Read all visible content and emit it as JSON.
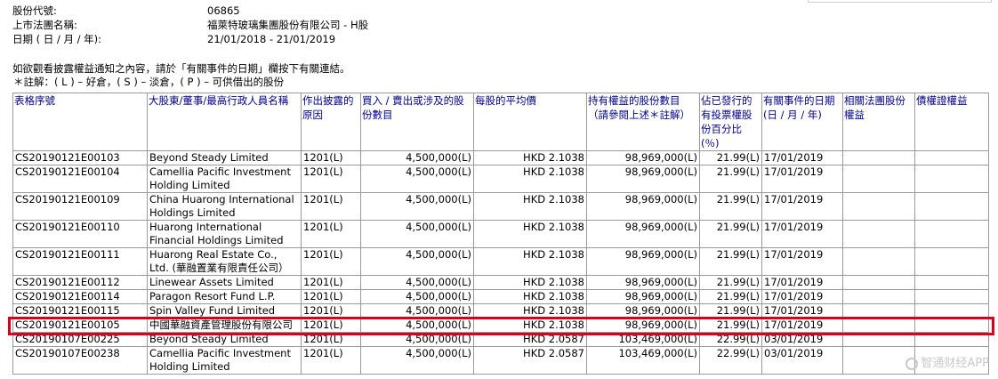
{
  "info": {
    "stock_code_label": "股份代號:",
    "stock_code": "06865",
    "company_label": "上市法團名稱:",
    "company": "福萊特玻璃集團股份有限公司 - H股",
    "date_label": "日期 ( 日 / 月 / 年):",
    "date_range": "21/01/2018 - 21/01/2019"
  },
  "notice": {
    "line1": "如欲觀看披露權益通知之內容，請於「有關事件的日期」欄按下有關連結。",
    "line2": "＊註解：(  L  ) – 好倉，(  S  ) – 淡倉，(  P  ) – 可供借出的股份"
  },
  "table": {
    "headers": [
      "表格序號",
      "大股東/董事/最高行政人員名稱",
      "作出披露的原因",
      "買入 / 賣出或涉及的股份數目",
      "每股的平均價",
      "持有權益的股份數目 （請參閱上述＊註解）",
      "佔已發行的有投票權股份百分比 (％)",
      "有關事件的日期 (日 / 月 / 年)",
      "相關法團股份權益",
      "債權證權益"
    ],
    "rows": [
      {
        "code": "CS20190121E00103",
        "name": "Beyond Steady Limited",
        "reason": "1201(L)",
        "shares": "4,500,000(L)",
        "price": "HKD 2.1038",
        "held": "98,969,000(L)",
        "pct": "21.99(L)",
        "date": "17/01/2019"
      },
      {
        "code": "CS20190121E00104",
        "name": "Camellia Pacific Investment Holding Limited",
        "reason": "1201(L)",
        "shares": "4,500,000(L)",
        "price": "HKD 2.1038",
        "held": "98,969,000(L)",
        "pct": "21.99(L)",
        "date": "17/01/2019"
      },
      {
        "code": "CS20190121E00109",
        "name": "China Huarong International Holdings Limited",
        "reason": "1201(L)",
        "shares": "4,500,000(L)",
        "price": "HKD 2.1038",
        "held": "98,969,000(L)",
        "pct": "21.99(L)",
        "date": "17/01/2019"
      },
      {
        "code": "CS20190121E00110",
        "name": "Huarong International Financial Holdings Limited",
        "reason": "1201(L)",
        "shares": "4,500,000(L)",
        "price": "HKD 2.1038",
        "held": "98,969,000(L)",
        "pct": "21.99(L)",
        "date": "17/01/2019"
      },
      {
        "code": "CS20190121E00111",
        "name": "Huarong Real Estate Co., Ltd. (華融置業有限責任公司）",
        "reason": "1201(L)",
        "shares": "4,500,000(L)",
        "price": "HKD 2.1038",
        "held": "98,969,000(L)",
        "pct": "21.99(L)",
        "date": "17/01/2019"
      },
      {
        "code": "CS20190121E00112",
        "name": "Linewear Assets Limited",
        "reason": "1201(L)",
        "shares": "4,500,000(L)",
        "price": "HKD 2.1038",
        "held": "98,969,000(L)",
        "pct": "21.99(L)",
        "date": "17/01/2019"
      },
      {
        "code": "CS20190121E00114",
        "name": "Paragon Resort Fund L.P.",
        "reason": "1201(L)",
        "shares": "4,500,000(L)",
        "price": "HKD 2.1038",
        "held": "98,969,000(L)",
        "pct": "21.99(L)",
        "date": "17/01/2019"
      },
      {
        "code": "CS20190121E00115",
        "name": "Spin Valley Fund Limited",
        "reason": "1201(L)",
        "shares": "4,500,000(L)",
        "price": "HKD 2.1038",
        "held": "98,969,000(L)",
        "pct": "21.99(L)",
        "date": "17/01/2019"
      },
      {
        "code": "CS20190121E00105",
        "name": "中國華融資產管理股份有限公司",
        "reason": "1201(L)",
        "shares": "4,500,000(L)",
        "price": "HKD 2.1038",
        "held": "98,969,000(L)",
        "pct": "21.99(L)",
        "date": "17/01/2019"
      },
      {
        "code": "CS20190107E00225",
        "name": "Beyond Steady Limited",
        "reason": "1201(L)",
        "shares": "4,500,000(L)",
        "price": "HKD 2.0587",
        "held": "103,469,000(L)",
        "pct": "22.99(L)",
        "date": "03/01/2019"
      },
      {
        "code": "CS20190107E00238",
        "name": "Camellia Pacific Investment Holding Limited",
        "reason": "1201(L)",
        "shares": "4,500,000(L)",
        "price": "HKD 2.0587",
        "held": "103,469,000(L)",
        "pct": "22.99(L)",
        "date": "03/01/2019"
      }
    ]
  },
  "watermark": "智通财经APP",
  "colors": {
    "header_text": "#00008b",
    "highlight": "#d8001f",
    "grid": "#9a9a9a"
  }
}
